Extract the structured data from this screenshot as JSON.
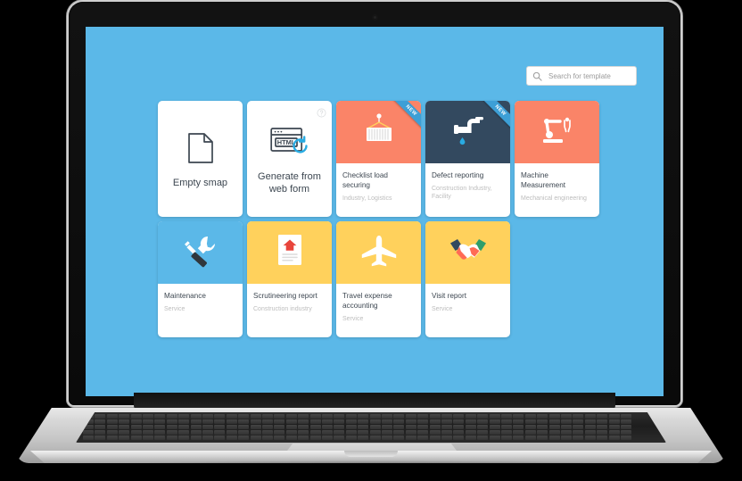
{
  "app": {
    "background_color": "#5BB8E8",
    "device": "laptop"
  },
  "search": {
    "placeholder": "Search for template",
    "value": "",
    "icon": "search-icon"
  },
  "badges": {
    "new_label": "NEW"
  },
  "icons": {
    "help": "help-circle-icon"
  },
  "cards": [
    {
      "id": "empty-smap",
      "kind": "action",
      "title": "Empty smap",
      "subtitle": "",
      "icon": "document-icon",
      "thumb_color": "#FFFFFF",
      "badge": "",
      "has_help": false
    },
    {
      "id": "generate-from-web-form",
      "kind": "action",
      "title": "Generate from\nweb form",
      "subtitle": "",
      "icon": "html-browser-refresh-icon",
      "thumb_color": "#FFFFFF",
      "badge": "",
      "has_help": true
    },
    {
      "id": "checklist-load-securing",
      "kind": "template",
      "title": "Checklist load\nsecuring",
      "subtitle": "Industry, Logistics",
      "icon": "shipping-container-crane-icon",
      "thumb_color": "#FA8468",
      "badge": "NEW",
      "has_help": false
    },
    {
      "id": "defect-reporting",
      "kind": "template",
      "title": "Defect reporting",
      "subtitle": "Construction Industry,\nFacility",
      "icon": "faucet-water-drop-icon",
      "thumb_color": "#33495F",
      "badge": "NEW",
      "has_help": false
    },
    {
      "id": "machine-measurement",
      "kind": "template",
      "title": "Machine\nMeasurement",
      "subtitle": "Mechanical engineering",
      "icon": "robotic-arm-caliper-icon",
      "thumb_color": "#FA8468",
      "badge": "",
      "has_help": false
    },
    {
      "id": "maintenance",
      "kind": "template",
      "title": "Maintenance",
      "subtitle": "Service",
      "icon": "wrench-screwdriver-icon",
      "thumb_color": "#5BB8E8",
      "badge": "",
      "has_help": false
    },
    {
      "id": "scrutineering-report",
      "kind": "template",
      "title": "Scrutineering report",
      "subtitle": "Construction industry",
      "icon": "house-document-icon",
      "thumb_color": "#FFD15C",
      "badge": "",
      "has_help": false
    },
    {
      "id": "travel-expense-accounting",
      "kind": "template",
      "title": "Travel expense\naccounting",
      "subtitle": "Service",
      "icon": "airplane-icon",
      "thumb_color": "#FFD15C",
      "badge": "",
      "has_help": false
    },
    {
      "id": "visit-report",
      "kind": "template",
      "title": "Visit report",
      "subtitle": "Service",
      "icon": "handshake-icon",
      "thumb_color": "#FFD15C",
      "badge": "",
      "has_help": false
    }
  ]
}
